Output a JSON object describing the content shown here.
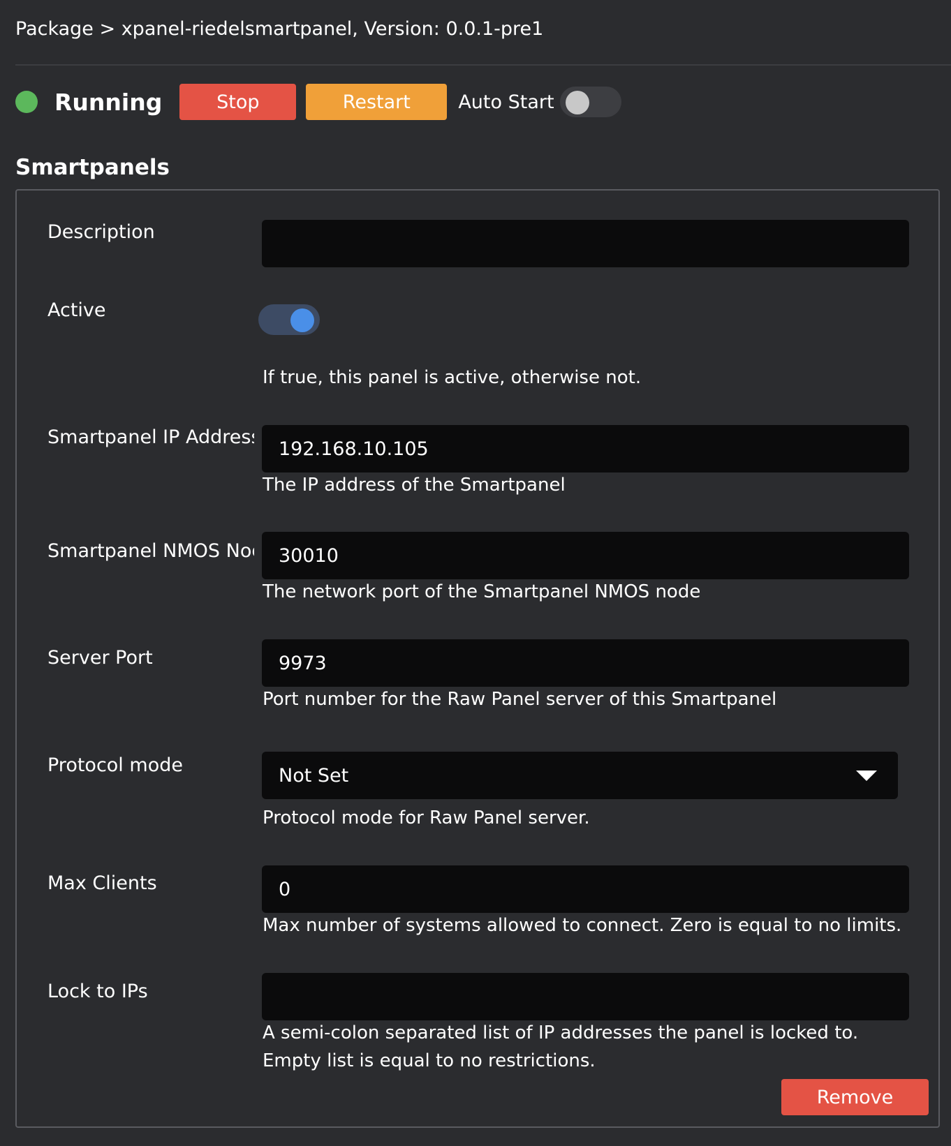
{
  "breadcrumb": "Package > xpanel-riedelsmartpanel, Version: 0.0.1-pre1",
  "status": {
    "text": "Running",
    "stop_label": "Stop",
    "restart_label": "Restart",
    "autostart_label": "Auto Start",
    "autostart_on": false
  },
  "section": {
    "title": "Smartpanels"
  },
  "fields": {
    "description": {
      "label": "Description",
      "value": ""
    },
    "active": {
      "label": "Active",
      "on": true,
      "help": "If true, this panel is active, otherwise not."
    },
    "ip": {
      "label": "Smartpanel IP Address",
      "value": "192.168.10.105",
      "help": "The IP address of the Smartpanel"
    },
    "nmos_port": {
      "label": "Smartpanel NMOS Node Port",
      "value": "30010",
      "help": "The network port of the Smartpanel NMOS node"
    },
    "server_port": {
      "label": "Server Port",
      "value": "9973",
      "help": "Port number for the Raw Panel server of this Smartpanel"
    },
    "protocol_mode": {
      "label": "Protocol mode",
      "value": "Not Set",
      "help": "Protocol mode for Raw Panel server."
    },
    "max_clients": {
      "label": "Max Clients",
      "value": "0",
      "help": "Max number of systems allowed to connect. Zero is equal to no limits."
    },
    "lock_ips": {
      "label": "Lock to IPs",
      "value": "",
      "help": "A semi-colon separated list of IP addresses the panel is locked to. Empty list is equal to no restrictions."
    }
  },
  "remove_label": "Remove",
  "colors": {
    "background": "#2b2c2f",
    "running": "#5cb85c",
    "stop": "#e45345",
    "restart": "#f0a039",
    "toggle_on": "#4a8fe8"
  }
}
